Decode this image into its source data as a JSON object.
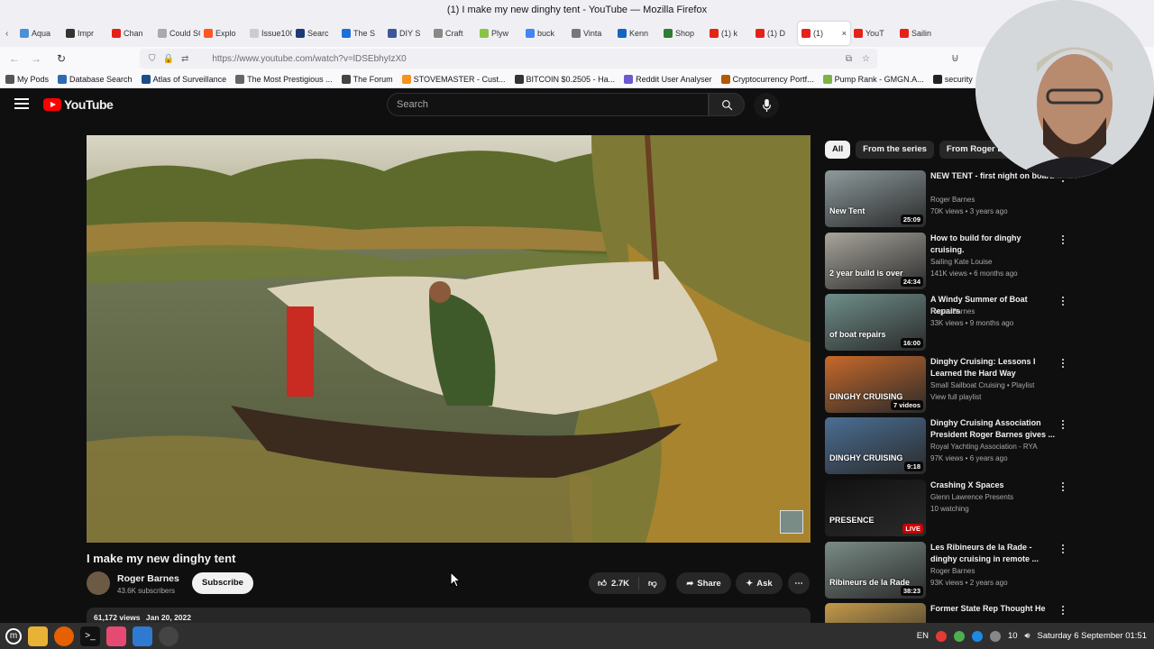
{
  "window": {
    "title": "(1) I make my new dinghy tent - YouTube — Mozilla Firefox"
  },
  "tabs": [
    {
      "label": "Aqua",
      "color": "#4a90d9"
    },
    {
      "label": "Impr",
      "color": "#333333"
    },
    {
      "label": "Chan",
      "color": "#e62117"
    },
    {
      "label": "Could SC",
      "color": "#aaaaaa"
    },
    {
      "label": "Explo",
      "color": "#ff5722"
    },
    {
      "label": "Issue100",
      "color": "#cccccc"
    },
    {
      "label": "Searc",
      "color": "#1b3a7a"
    },
    {
      "label": "The S",
      "color": "#1e6fd9"
    },
    {
      "label": "DIY S",
      "color": "#3b5998"
    },
    {
      "label": "Craft",
      "color": "#888888"
    },
    {
      "label": "Plyw",
      "color": "#8bc34a"
    },
    {
      "label": "buck",
      "color": "#4285f4"
    },
    {
      "label": "Vinta",
      "color": "#777777"
    },
    {
      "label": "Kenn",
      "color": "#1565c0"
    },
    {
      "label": "Shop",
      "color": "#2e7d32"
    },
    {
      "label": "(1) k",
      "color": "#e62117"
    },
    {
      "label": "(1) D",
      "color": "#e62117"
    },
    {
      "label": "(1)",
      "color": "#e62117",
      "active": true
    },
    {
      "label": "YouT",
      "color": "#e62117"
    },
    {
      "label": "Sailin",
      "color": "#e62117"
    }
  ],
  "nav": {
    "url": "https://www.youtube.com/watch?v=lDSEbhyIzX0"
  },
  "bookmarks": [
    {
      "label": "My Pods",
      "color": "#555555"
    },
    {
      "label": "Database Search",
      "color": "#2b6cb0"
    },
    {
      "label": "Atlas of Surveillance",
      "color": "#1a4e8a"
    },
    {
      "label": "The Most Prestigious ...",
      "color": "#666666"
    },
    {
      "label": "The Forum",
      "color": "#444444"
    },
    {
      "label": "STOVEMASTER - Cust...",
      "color": "#f7931a"
    },
    {
      "label": "BITCOIN $0.2505 - Ha...",
      "color": "#333333"
    },
    {
      "label": "Reddit User Analyser",
      "color": "#6a5acd"
    },
    {
      "label": "Cryptocurrency Portf...",
      "color": "#b35900"
    },
    {
      "label": "Pump Rank - GMGN.A...",
      "color": "#7cb342"
    },
    {
      "label": "security",
      "color": "#222222"
    }
  ],
  "youtube": {
    "logo": "YouTube",
    "search_placeholder": "Search",
    "video": {
      "title": "I make my new dinghy tent",
      "channel": "Roger Barnes",
      "subscribers": "43.6K subscribers",
      "subscribe_label": "Subscribe",
      "likes": "2.7K",
      "share_label": "Share",
      "ask_label": "Ask",
      "views": "61,172 views",
      "date": "Jan 20, 2022"
    },
    "chips": [
      {
        "label": "All",
        "active": true
      },
      {
        "label": "From the series"
      },
      {
        "label": "From Roger Barnes"
      }
    ],
    "recommendations": [
      {
        "title": "NEW TENT - first night on board",
        "channel": "Roger Barnes",
        "meta": "70K views • 3 years ago",
        "duration": "25:09",
        "thumb_text": "New Tent",
        "thumb_color": "#8d9a9c"
      },
      {
        "title": "How to build for dinghy cruising.",
        "channel": "Sailing Kate Louise",
        "meta": "141K views • 6 months ago",
        "duration": "24:34",
        "thumb_text": "2 year build is over",
        "thumb_color": "#a8a59c"
      },
      {
        "title": "A Windy Summer of Boat Repairs",
        "channel": "Roger Barnes",
        "meta": "33K views • 9 months ago",
        "duration": "16:00",
        "thumb_text": "of boat repairs",
        "thumb_color": "#6f8f8a"
      },
      {
        "title": "Dinghy Cruising: Lessons I Learned the Hard Way",
        "channel": "Small Sailboat Cruising • Playlist",
        "meta": "View full playlist",
        "duration": "7 videos",
        "thumb_text": "DINGHY CRUISING",
        "thumb_color": "#c8692a"
      },
      {
        "title": "Dinghy Cruising Association President Roger Barnes gives ...",
        "channel": "Royal Yachting Association - RYA",
        "meta": "97K views • 6 years ago",
        "duration": "9:18",
        "thumb_text": "DINGHY CRUISING",
        "thumb_color": "#4a6f95"
      },
      {
        "title": "Crashing X Spaces",
        "channel": "Glenn Lawrence Presents",
        "meta": "10 watching",
        "duration": "LIVE",
        "thumb_text": "PRESENCE",
        "thumb_color": "#111111"
      },
      {
        "title": "Les Ribineurs de la Rade - dinghy cruising in remote ...",
        "channel": "Roger Barnes",
        "meta": "93K views • 2 years ago",
        "duration": "38:23",
        "thumb_text": "Ribineurs de la Rade",
        "thumb_color": "#7a8c86"
      },
      {
        "title": "Former State Rep Thought He",
        "channel": "",
        "meta": "",
        "duration": "",
        "thumb_text": "",
        "thumb_color": "#c49a4a"
      }
    ]
  },
  "taskbar": {
    "lang": "EN",
    "volume": "10",
    "clock": "Saturday  6 September 01:51"
  }
}
